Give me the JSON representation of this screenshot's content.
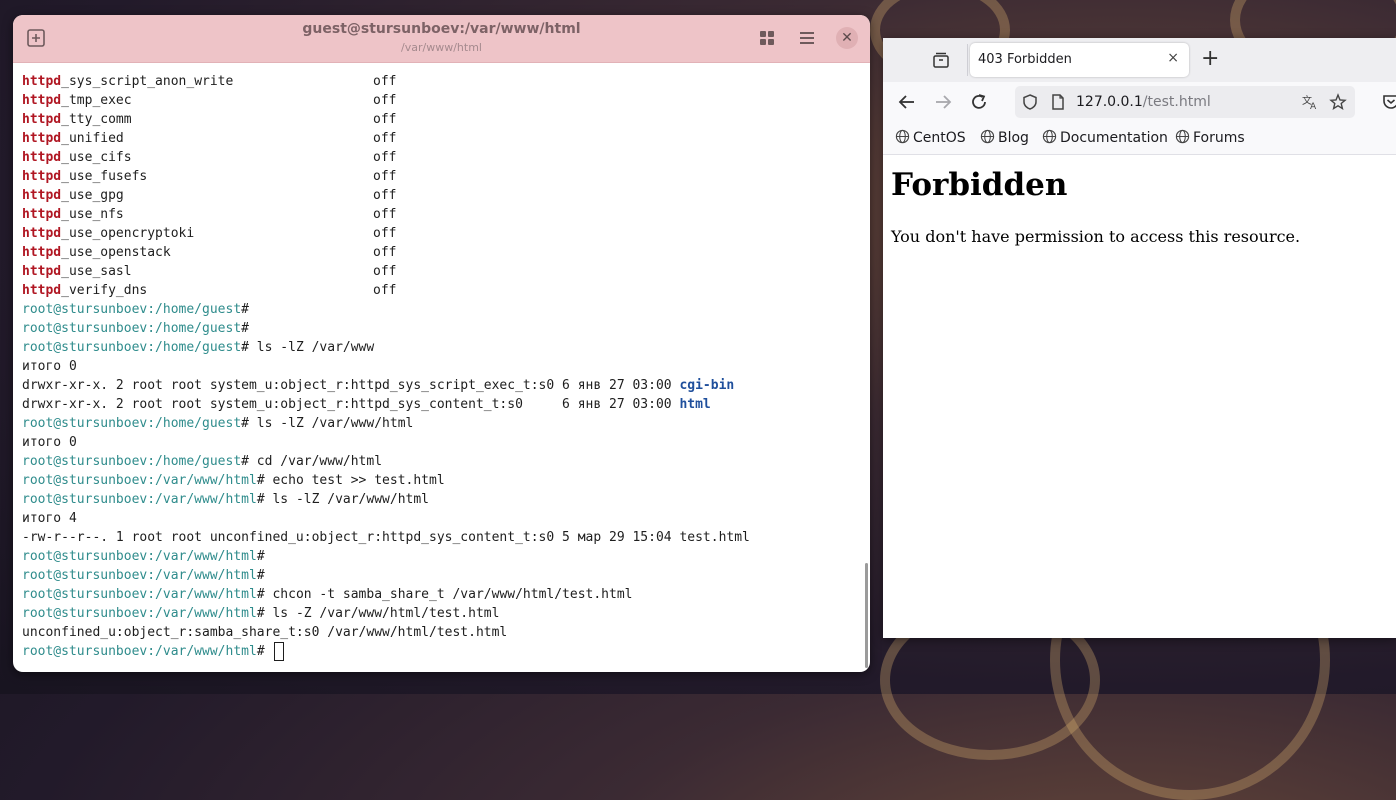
{
  "terminal": {
    "title": "guest@stursunboev:/var/www/html",
    "subtitle": "/var/www/html",
    "booleans": [
      {
        "kw": "httpd",
        "rest": "_sys_script_anon_write",
        "value": "off"
      },
      {
        "kw": "httpd",
        "rest": "_tmp_exec",
        "value": "off"
      },
      {
        "kw": "httpd",
        "rest": "_tty_comm",
        "value": "off"
      },
      {
        "kw": "httpd",
        "rest": "_unified",
        "value": "off"
      },
      {
        "kw": "httpd",
        "rest": "_use_cifs",
        "value": "off"
      },
      {
        "kw": "httpd",
        "rest": "_use_fusefs",
        "value": "off"
      },
      {
        "kw": "httpd",
        "rest": "_use_gpg",
        "value": "off"
      },
      {
        "kw": "httpd",
        "rest": "_use_nfs",
        "value": "off"
      },
      {
        "kw": "httpd",
        "rest": "_use_opencryptoki",
        "value": "off"
      },
      {
        "kw": "httpd",
        "rest": "_use_openstack",
        "value": "off"
      },
      {
        "kw": "httpd",
        "rest": "_use_sasl",
        "value": "off"
      },
      {
        "kw": "httpd",
        "rest": "_verify_dns",
        "value": "off"
      }
    ],
    "lines": [
      {
        "prompt": "root@stursunboev:/home/guest",
        "cmd": "#"
      },
      {
        "prompt": "root@stursunboev:/home/guest",
        "cmd": "#"
      },
      {
        "prompt": "root@stursunboev:/home/guest",
        "cmd": "# ls -lZ /var/www"
      },
      {
        "text": "итого 0"
      },
      {
        "text": "drwxr-xr-x. 2 root root system_u:object_r:httpd_sys_script_exec_t:s0 6 янв 27 03:00 ",
        "dir": "cgi-bin"
      },
      {
        "text": "drwxr-xr-x. 2 root root system_u:object_r:httpd_sys_content_t:s0     6 янв 27 03:00 ",
        "dir": "html"
      },
      {
        "prompt": "root@stursunboev:/home/guest",
        "cmd": "# ls -lZ /var/www/html"
      },
      {
        "text": "итого 0"
      },
      {
        "prompt": "root@stursunboev:/home/guest",
        "cmd": "# cd /var/www/html"
      },
      {
        "prompt": "root@stursunboev:/var/www/html",
        "cmd": "# echo test >> test.html"
      },
      {
        "prompt": "root@stursunboev:/var/www/html",
        "cmd": "# ls -lZ /var/www/html"
      },
      {
        "text": "итого 4"
      },
      {
        "text": "-rw-r--r--. 1 root root unconfined_u:object_r:httpd_sys_content_t:s0 5 мар 29 15:04 test.html"
      },
      {
        "prompt": "root@stursunboev:/var/www/html",
        "cmd": "#"
      },
      {
        "prompt": "root@stursunboev:/var/www/html",
        "cmd": "#"
      },
      {
        "prompt": "root@stursunboev:/var/www/html",
        "cmd": "# chcon -t samba_share_t /var/www/html/test.html"
      },
      {
        "prompt": "root@stursunboev:/var/www/html",
        "cmd": "# ls -Z /var/www/html/test.html"
      },
      {
        "text": "unconfined_u:object_r:samba_share_t:s0 /var/www/html/test.html"
      },
      {
        "prompt": "root@stursunboev:/var/www/html",
        "cmd": "# ",
        "cursor": true
      }
    ]
  },
  "browser": {
    "tab_title": "403 Forbidden",
    "tab_close": "×",
    "new_tab": "+",
    "url_host": "127.0.0.1",
    "url_path": "/test.html",
    "bookmarks": [
      "CentOS",
      "Blog",
      "Documentation",
      "Forums"
    ],
    "page_heading": "Forbidden",
    "page_text": "You don't have permission to access this resource."
  },
  "icons": {
    "terminal_new_tab": "new-tab-icon",
    "terminal_grid": "grid-icon",
    "terminal_menu": "menu-icon",
    "terminal_close": "close-icon",
    "browser_tabs": "tab-tray-icon",
    "back": "back-arrow-icon",
    "forward": "forward-arrow-icon",
    "reload": "reload-icon",
    "shield": "shield-icon",
    "page": "page-icon",
    "translate": "translate-icon",
    "star": "star-icon",
    "pocket": "pocket-icon",
    "globe": "globe-icon"
  },
  "colors": {
    "terminal_header": "#eec4c8",
    "httpd_keyword": "#b01622",
    "prompt": "#2f8c8c",
    "directory": "#1f4f9c"
  }
}
